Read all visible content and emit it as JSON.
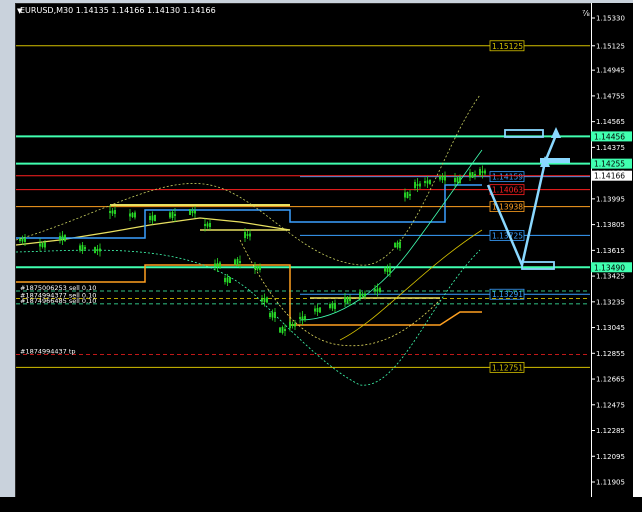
{
  "window": {
    "symbol_header": "EURUSD,M30  1.14135 1.14166 1.14130 1.14166",
    "corner_glyph": "⅞"
  },
  "price_axis": {
    "ticks": [
      "1.15330",
      "1.15125",
      "1.14945",
      "1.14755",
      "1.14565",
      "1.14375",
      "1.14185",
      "1.13995",
      "1.13805",
      "1.13615",
      "1.13425",
      "1.13235",
      "1.13045",
      "1.12855",
      "1.12665",
      "1.12475",
      "1.12285",
      "1.12095",
      "1.11905"
    ],
    "tick_values": [
      1.1533,
      1.15125,
      1.14945,
      1.14755,
      1.14565,
      1.14375,
      1.14185,
      1.13995,
      1.13805,
      1.13615,
      1.13425,
      1.13235,
      1.13045,
      1.12855,
      1.12665,
      1.12475,
      1.12285,
      1.12095,
      1.11905
    ],
    "badges": [
      {
        "text": "1.14456",
        "value": 1.14456,
        "bg": "#40ffb0",
        "fg": "#000000"
      },
      {
        "text": "1.14255",
        "value": 1.14255,
        "bg": "#40ffb0",
        "fg": "#000000"
      },
      {
        "text": "1.14166",
        "value": 1.14166,
        "bg": "#ffffff",
        "fg": "#000000"
      },
      {
        "text": "1.13490",
        "value": 1.1349,
        "bg": "#40ffb0",
        "fg": "#000000"
      }
    ]
  },
  "levels": [
    {
      "label": "1.15125",
      "value": 1.15125,
      "color": "#d4c000",
      "style": "solid"
    },
    {
      "label": "1.14159",
      "value": 1.14159,
      "color": "#3aa0ff",
      "style": "solid"
    },
    {
      "label": "1.14063",
      "value": 1.14063,
      "color": "#ff2020",
      "style": "solid"
    },
    {
      "label": "1.13938",
      "value": 1.13938,
      "color": "#ffa020",
      "style": "solid"
    },
    {
      "label": "1.13725",
      "value": 1.13725,
      "color": "#3aa0ff",
      "style": "solid"
    },
    {
      "label": "1.13291",
      "value": 1.13291,
      "color": "#3aa0ff",
      "style": "solid"
    },
    {
      "label": "1.12751",
      "value": 1.12751,
      "color": "#d4c000",
      "style": "solid"
    }
  ],
  "zones": [
    {
      "value": 1.14456,
      "color": "#40ffb0"
    },
    {
      "value": 1.14255,
      "color": "#40ffb0"
    },
    {
      "value": 1.1349,
      "color": "#40ffb0"
    }
  ],
  "orders": [
    {
      "text": "#1875006253 sell 0.10",
      "value": 1.13315
    },
    {
      "text": "#1874994377 sell 0.10",
      "value": 1.1326
    },
    {
      "text": "#1874966485 sell 0.10",
      "value": 1.1322
    },
    {
      "text": "#1874994437 tp",
      "value": 1.12845
    }
  ],
  "colors": {
    "background": "#000000",
    "candle": "#28e028",
    "projection": "#8ad8ff",
    "stop_line": "#ff2020"
  }
}
